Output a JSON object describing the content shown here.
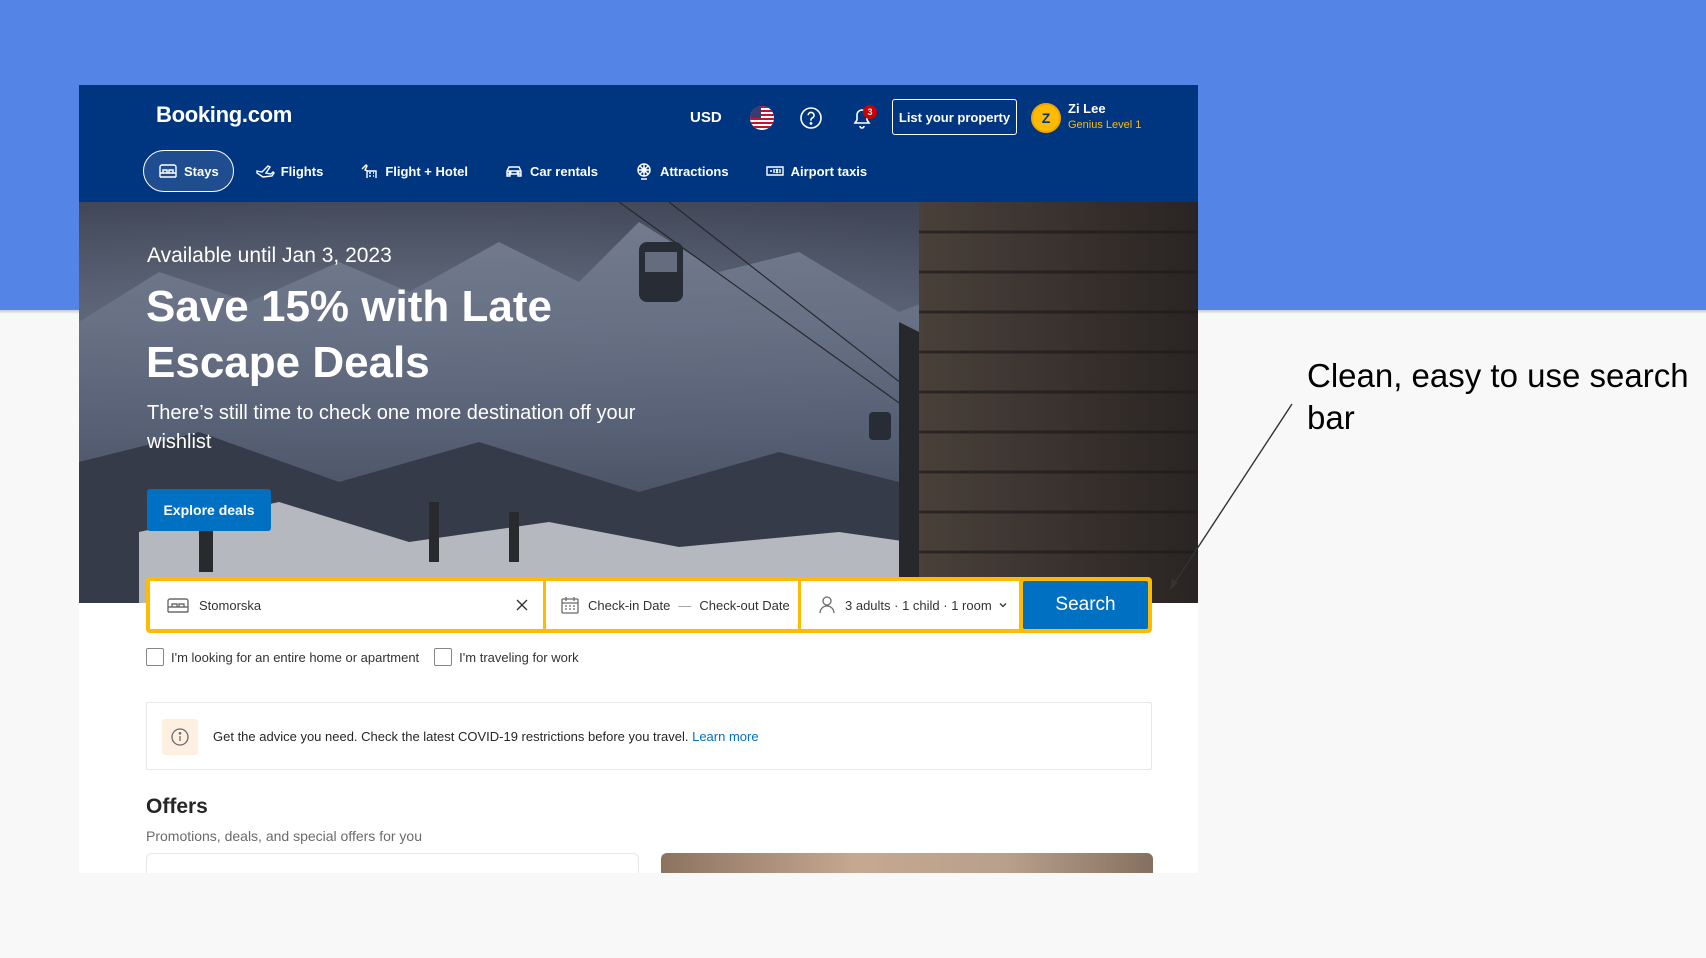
{
  "header": {
    "logo": "Booking.com",
    "currency": "USD",
    "notification_count": "3",
    "list_property_label": "List your property",
    "user": {
      "initial": "Z",
      "name": "Zi Lee",
      "level": "Genius Level 1"
    }
  },
  "nav": {
    "items": [
      {
        "label": "Stays",
        "icon": "bed-icon",
        "active": true
      },
      {
        "label": "Flights",
        "icon": "plane-icon"
      },
      {
        "label": "Flight + Hotel",
        "icon": "flight-hotel-icon"
      },
      {
        "label": "Car rentals",
        "icon": "car-icon"
      },
      {
        "label": "Attractions",
        "icon": "attractions-icon"
      },
      {
        "label": "Airport taxis",
        "icon": "taxi-icon"
      }
    ]
  },
  "hero": {
    "date": "Available until Jan 3, 2023",
    "title": "Save 15% with Late Escape Deals",
    "subtitle": "There’s still time to check one more destination off your wishlist",
    "cta": "Explore deals"
  },
  "search": {
    "destination": "Stomorska",
    "checkin": "Check-in Date",
    "checkout": "Check-out Date",
    "date_separator": "—",
    "guests": "3 adults · 1 child · 1 room",
    "button": "Search"
  },
  "checkboxes": {
    "entire_home": "I'm looking for an entire home or apartment",
    "work": "I'm traveling for work"
  },
  "covid": {
    "text": "Get the advice you need. Check the latest COVID-19 restrictions before you travel.",
    "link": "Learn more"
  },
  "offers": {
    "title": "Offers",
    "subtitle": "Promotions, deals, and special offers for you"
  },
  "annotation": "Clean, easy to use search bar",
  "colors": {
    "brand_blue": "#003580",
    "accent_yellow": "#febb02",
    "action_blue": "#0071c2",
    "slide_bg": "#5384e6"
  }
}
